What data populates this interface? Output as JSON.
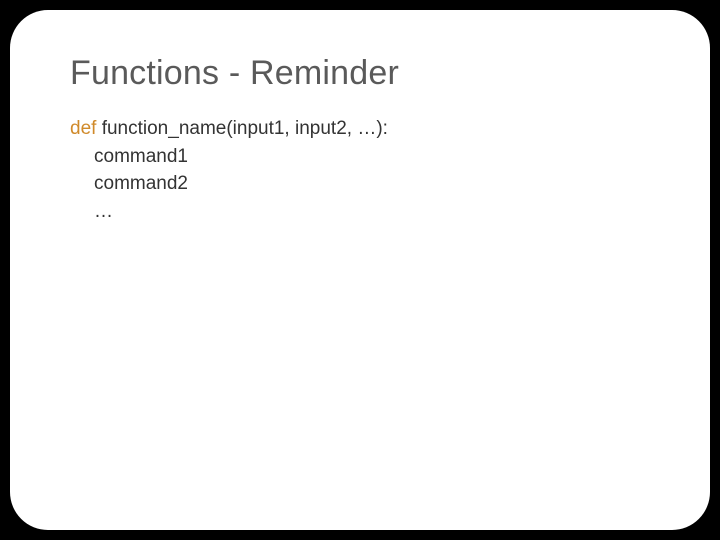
{
  "slide": {
    "title": "Functions - Reminder",
    "code": {
      "def_keyword": "def",
      "signature_rest": " function_name(input1, input2, …):",
      "body": [
        "command1",
        "command2",
        "…"
      ]
    }
  }
}
